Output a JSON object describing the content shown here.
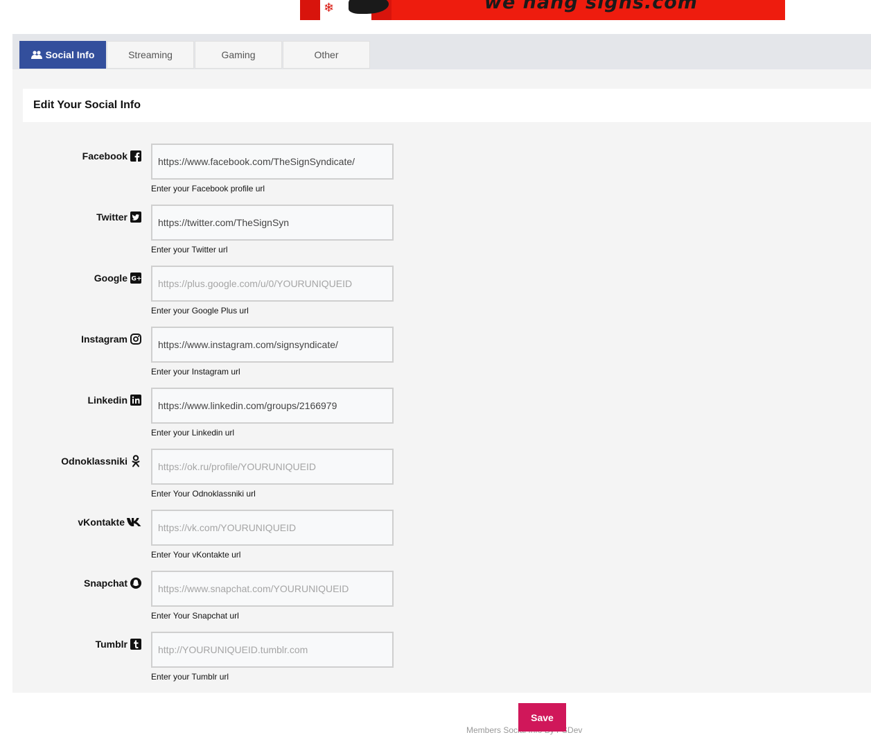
{
  "banner": {
    "slogan": "we hang signs.com"
  },
  "tabs": [
    {
      "label": "Social Info",
      "icon": "users-icon",
      "active": true
    },
    {
      "label": "Streaming",
      "active": false
    },
    {
      "label": "Gaming",
      "active": false
    },
    {
      "label": "Other",
      "active": false
    }
  ],
  "section_title": "Edit Your Social Info",
  "fields": [
    {
      "label": "Facebook",
      "icon": "facebook-icon",
      "value": "https://www.facebook.com/TheSignSyndicate/",
      "placeholder": "",
      "help": "Enter your Facebook profile url"
    },
    {
      "label": "Twitter",
      "icon": "twitter-icon",
      "value": "https://twitter.com/TheSignSyn",
      "placeholder": "",
      "help": "Enter your Twitter url"
    },
    {
      "label": "Google",
      "icon": "google-plus-icon",
      "value": "",
      "placeholder": "https://plus.google.com/u/0/YOURUNIQUEID",
      "help": "Enter your Google Plus url"
    },
    {
      "label": "Instagram",
      "icon": "instagram-icon",
      "value": "https://www.instagram.com/signsyndicate/",
      "placeholder": "",
      "help": "Enter your Instagram url"
    },
    {
      "label": "Linkedin",
      "icon": "linkedin-icon",
      "value": "https://www.linkedin.com/groups/2166979",
      "placeholder": "",
      "help": "Enter your Linkedin url"
    },
    {
      "label": "Odnoklassniki",
      "icon": "odnoklassniki-icon",
      "value": "",
      "placeholder": "https://ok.ru/profile/YOURUNIQUEID",
      "help": "Enter Your Odnoklassniki url"
    },
    {
      "label": "vKontakte",
      "icon": "vk-icon",
      "value": "",
      "placeholder": "https://vk.com/YOURUNIQUEID",
      "help": "Enter Your vKontakte url"
    },
    {
      "label": "Snapchat",
      "icon": "snapchat-icon",
      "value": "",
      "placeholder": "https://www.snapchat.com/YOURUNIQUEID",
      "help": "Enter Your Snapchat url"
    },
    {
      "label": "Tumblr",
      "icon": "tumblr-icon",
      "value": "",
      "placeholder": "http://YOURUNIQUEID.tumblr.com",
      "help": "Enter your Tumblr url"
    }
  ],
  "save_label": "Save",
  "credit": "Members Social Info By PSDev",
  "colors": {
    "tab_active": "#334f9c",
    "save_button": "#d0175a",
    "banner": "#ee1c0e"
  }
}
